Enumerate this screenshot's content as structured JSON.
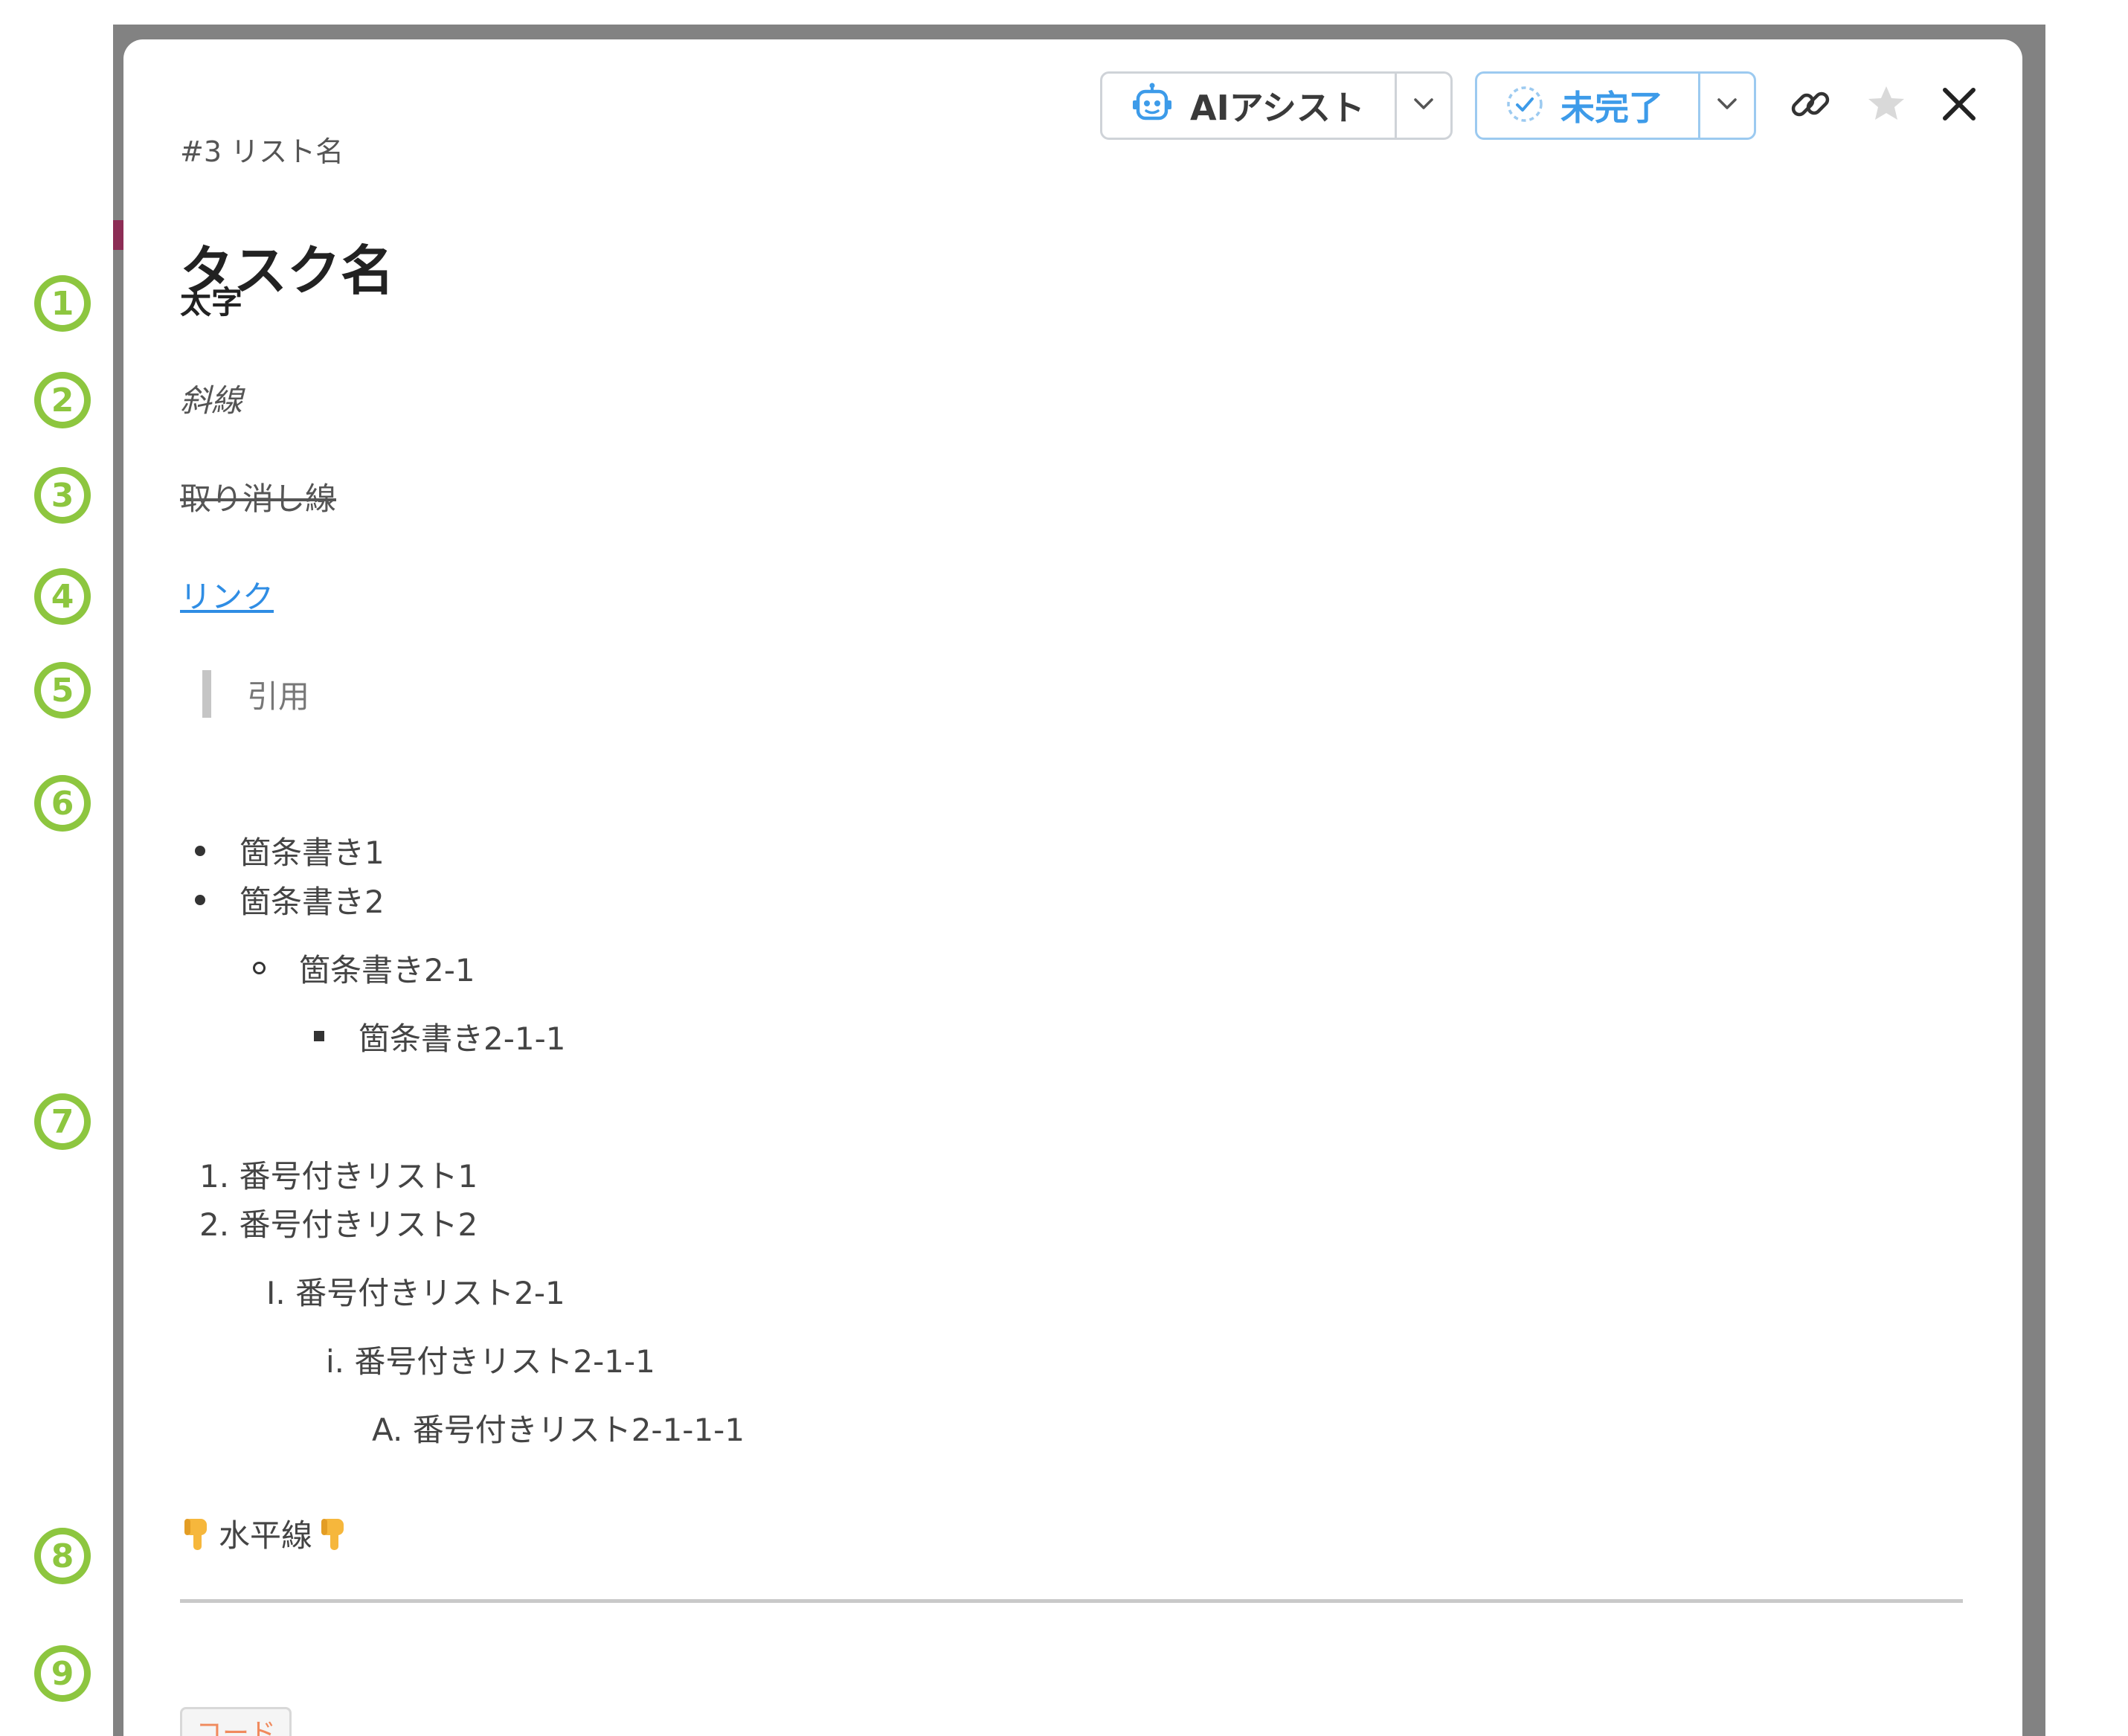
{
  "toolbar": {
    "ai_assist_label": "AIアシスト",
    "status_label": "未完了",
    "icons": [
      "robot-icon",
      "chevron-down-icon",
      "check-circle-icon",
      "link-icon",
      "star-icon",
      "close-icon"
    ]
  },
  "breadcrumb": "#3 リスト名",
  "task_title": "タスク名",
  "description": {
    "bold": "太字",
    "italic": "斜線",
    "strikethrough": "取り消し線",
    "link": "リンク",
    "quote": "引用",
    "bullets": [
      "箇条書き1",
      "箇条書き2",
      "箇条書き2-1",
      "箇条書き2-1-1"
    ],
    "numbered": [
      {
        "marker": "1.",
        "text": "番号付きリスト1"
      },
      {
        "marker": "2.",
        "text": "番号付きリスト2"
      },
      {
        "marker": "I.",
        "text": "番号付きリスト2-1"
      },
      {
        "marker": "i.",
        "text": "番号付きリスト2-1-1"
      },
      {
        "marker": "A.",
        "text": "番号付きリスト2-1-1-1"
      }
    ],
    "hr_caption": "水平線",
    "code": "コード"
  },
  "markers": [
    "1",
    "2",
    "3",
    "4",
    "5",
    "6",
    "7",
    "8",
    "9"
  ],
  "colors": {
    "accent_blue": "#3d9be9",
    "link_blue": "#2f8de4",
    "marker_green": "#8dc63f",
    "code_orange": "#f08a5d",
    "frame_gray": "#828282"
  }
}
